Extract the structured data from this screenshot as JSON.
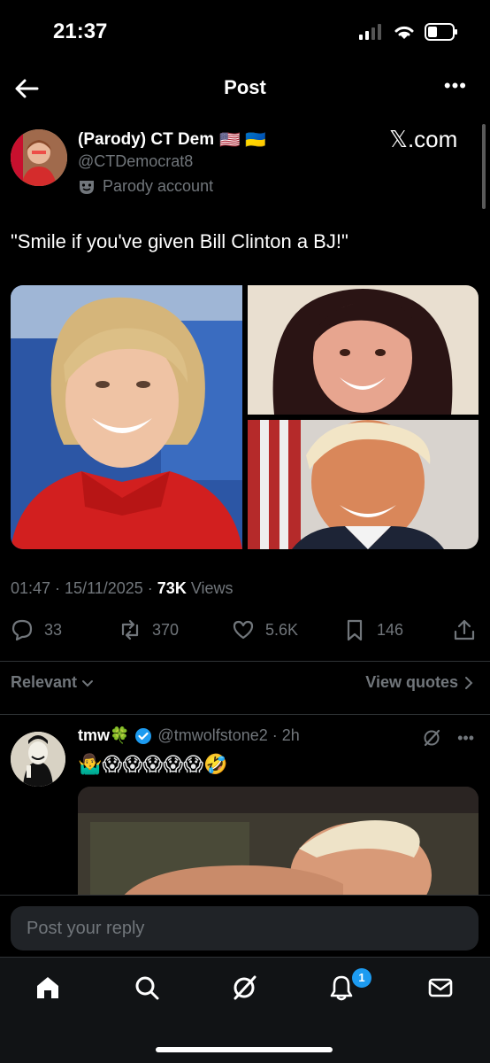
{
  "status_bar": {
    "time": "21:37"
  },
  "nav": {
    "title": "Post"
  },
  "post": {
    "author_name": "(Parody) CT Dem",
    "author_flags": "🇺🇸 🇺🇦",
    "handle": "@CTDemocrat8",
    "parody_label": "Parody account",
    "source_badge": "𝕏.com",
    "text": "\"Smile if you've given Bill Clinton a BJ!\"",
    "timestamp": "01:47 · 15/11/2025 · ",
    "views_count": "73K",
    "views_label": " Views",
    "replies": "33",
    "reposts": "370",
    "likes": "5.6K",
    "bookmarks": "146"
  },
  "sort": {
    "relevant_label": "Relevant",
    "view_quotes_label": "View quotes"
  },
  "reply": {
    "name": "tmw🍀",
    "handle_time": "@tmwolfstone2 · 2h",
    "text": "🤷‍♂️😱😱😱😱😱🤣"
  },
  "compose": {
    "placeholder": "Post your reply"
  },
  "tabbar": {
    "notifications_badge": "1"
  },
  "colors": {
    "accent": "#1d9bf0",
    "muted": "#71767b",
    "background": "#000000"
  }
}
